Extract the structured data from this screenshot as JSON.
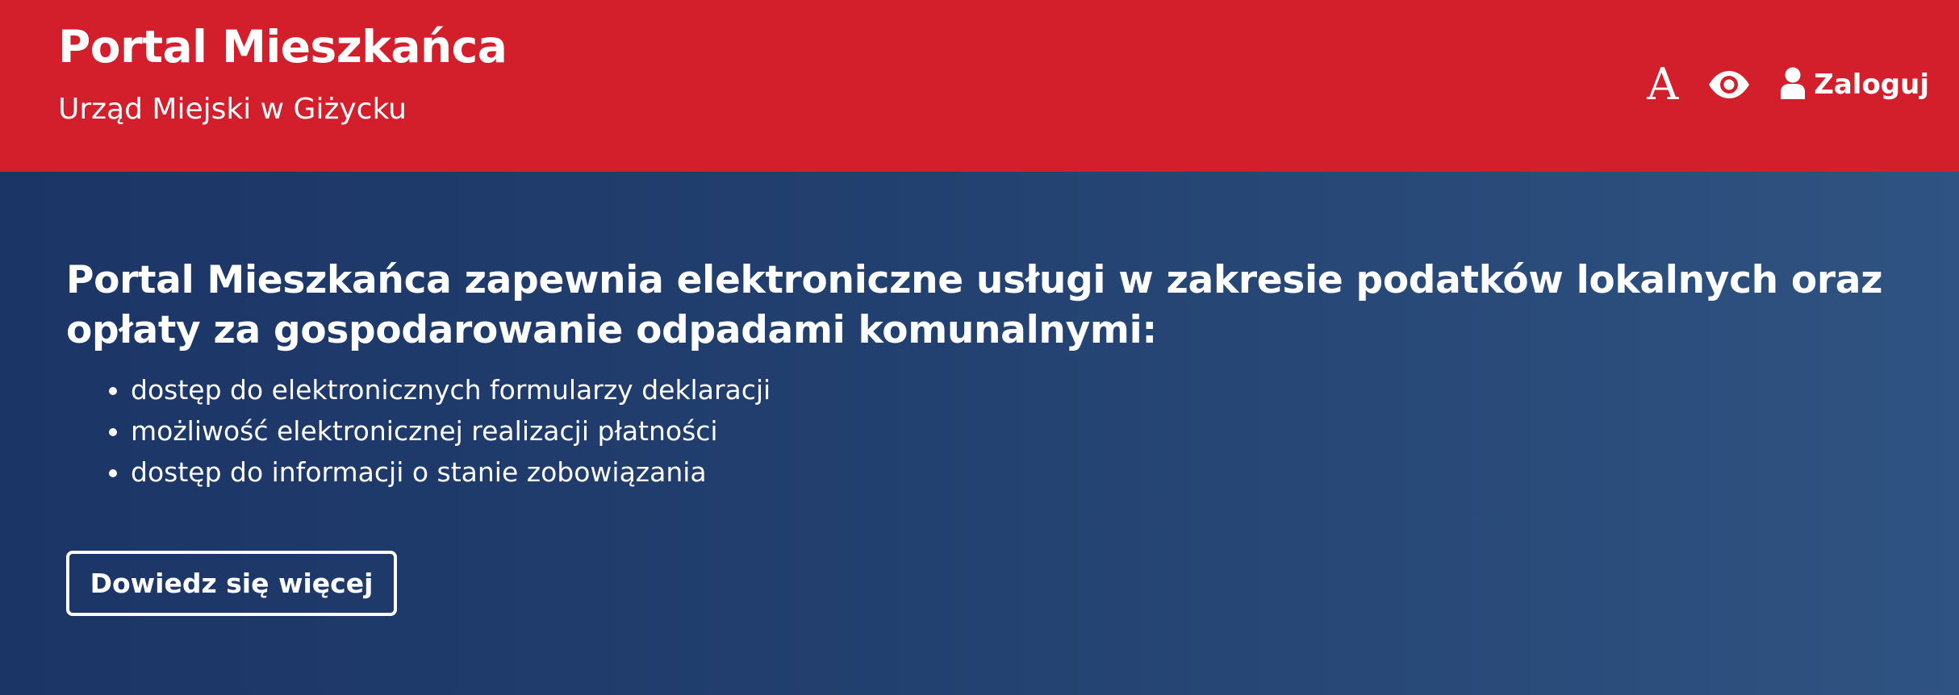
{
  "header": {
    "title": "Portal Mieszkańca",
    "subtitle": "Urząd Miejski w Giżycku",
    "font_size_button_label": "A",
    "login_label": "Zaloguj",
    "icons": [
      "font-size-icon",
      "eye-icon",
      "user-icon"
    ]
  },
  "hero": {
    "heading": "Portal Mieszkańca zapewnia elektroniczne usługi w zakresie podatków lokalnych oraz opłaty za gospodarowanie odpadami komunalnymi:",
    "features": [
      "dostęp do elektronicznych formularzy deklaracji",
      "możliwość elektronicznej realizacji płatności",
      "dostęp do informacji o stanie zobowiązania"
    ],
    "learn_more_label": "Dowiedz się więcej"
  },
  "colors": {
    "header_background": "#d31f2b",
    "hero_gradient_start": "#1b3566",
    "hero_gradient_end": "#2f5382",
    "text": "#ffffff"
  }
}
